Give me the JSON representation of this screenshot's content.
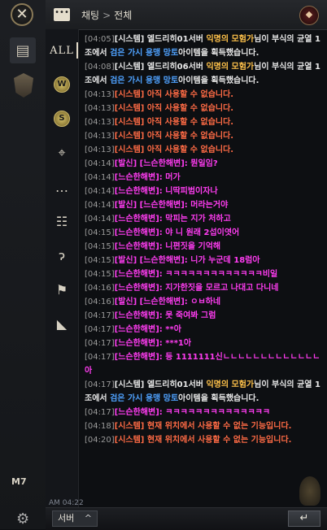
{
  "header": {
    "tab": "채팅",
    "sep": ">",
    "channel": "전체"
  },
  "rail": {
    "bottom_label": "M7"
  },
  "filters": [
    {
      "label": "ALL",
      "icon": "all-icon"
    },
    {
      "label": "W",
      "icon": "world-chat-icon"
    },
    {
      "label": "S",
      "icon": "server-chat-icon"
    },
    {
      "label": "",
      "icon": "location-pin-icon"
    },
    {
      "label": "",
      "icon": "speech-bubble-icon"
    },
    {
      "label": "",
      "icon": "party-icon"
    },
    {
      "label": "",
      "icon": "whisper-ear-icon"
    },
    {
      "label": "",
      "icon": "guild-banner-icon"
    },
    {
      "label": "",
      "icon": "megaphone-icon"
    }
  ],
  "messages": [
    {
      "type": "sys-white",
      "ts": "[04:05]",
      "parts": [
        [
          "",
          "[시스템] 엘드리히01서버 "
        ],
        [
          "gold",
          "익명의 모험가"
        ],
        [
          "",
          "님이 부식의 균열 1조에서 "
        ],
        [
          "blue",
          "검은 가시 용맹 망토"
        ],
        [
          "",
          "아이템을 획득했습니다."
        ]
      ]
    },
    {
      "type": "sys-white",
      "ts": "[04:08]",
      "parts": [
        [
          "",
          "[시스템] 엘드리히06서버 "
        ],
        [
          "gold",
          "익명의 모험가"
        ],
        [
          "",
          "님이 부식의 균열 1조에서 "
        ],
        [
          "blue",
          "검은 가시 용맹 망토"
        ],
        [
          "",
          "아이템을 획득했습니다."
        ]
      ]
    },
    {
      "type": "sys",
      "ts": "[04:13]",
      "parts": [
        [
          "",
          "[시스템] 아직 사용할 수 없습니다."
        ]
      ]
    },
    {
      "type": "sys",
      "ts": "[04:13]",
      "parts": [
        [
          "",
          "[시스템] 아직 사용할 수 없습니다."
        ]
      ]
    },
    {
      "type": "sys",
      "ts": "[04:13]",
      "parts": [
        [
          "",
          "[시스템] 아직 사용할 수 없습니다."
        ]
      ]
    },
    {
      "type": "sys",
      "ts": "[04:13]",
      "parts": [
        [
          "",
          "[시스템] 아직 사용할 수 없습니다."
        ]
      ]
    },
    {
      "type": "sys",
      "ts": "[04:13]",
      "parts": [
        [
          "",
          "[시스템] 아직 사용할 수 없습니다."
        ]
      ]
    },
    {
      "type": "shout",
      "ts": "[04:14]",
      "parts": [
        [
          "",
          "[발신] [느슨한해변]: 뭔일임?"
        ]
      ]
    },
    {
      "type": "shout",
      "ts": "[04:14]",
      "parts": [
        [
          "",
          "[느슨한해변]: 머가"
        ]
      ]
    },
    {
      "type": "shout",
      "ts": "[04:14]",
      "parts": [
        [
          "",
          "[느슨한해변]: 니딱피범이자나"
        ]
      ]
    },
    {
      "type": "shout",
      "ts": "[04:14]",
      "parts": [
        [
          "",
          "[발신] [느슨한해변]: 머라는거야"
        ]
      ]
    },
    {
      "type": "shout",
      "ts": "[04:14]",
      "parts": [
        [
          "",
          "[느슨한해변]: 막피는 지가 처하고"
        ]
      ]
    },
    {
      "type": "shout",
      "ts": "[04:15]",
      "parts": [
        [
          "",
          "[느슨한해변]: 야 니 원래 2섭이엿어"
        ]
      ]
    },
    {
      "type": "shout",
      "ts": "[04:15]",
      "parts": [
        [
          "",
          "[느슨한해변]: 니편짓을 기억해"
        ]
      ]
    },
    {
      "type": "shout",
      "ts": "[04:15]",
      "parts": [
        [
          "",
          "[발신] [느슨한해변]: 니가 누군데 18럼아"
        ]
      ]
    },
    {
      "type": "shout",
      "ts": "[04:15]",
      "parts": [
        [
          "",
          "[느슨한해변]: ㅋㅋㅋㅋㅋㅋㅋㅋㅋㅋㅋㅋㅋ비일"
        ]
      ]
    },
    {
      "type": "shout",
      "ts": "[04:16]",
      "parts": [
        [
          "",
          "[느슨한해변]: 지가한짓을 모르고 나대고 다니네"
        ]
      ]
    },
    {
      "type": "shout",
      "ts": "[04:16]",
      "parts": [
        [
          "",
          "[발신] [느슨한해변]: ㅇㅂ하네"
        ]
      ]
    },
    {
      "type": "shout",
      "ts": "[04:17]",
      "parts": [
        [
          "",
          "[느슨한해변]: 못 죽여봐 그럼"
        ]
      ]
    },
    {
      "type": "shout",
      "ts": "[04:17]",
      "parts": [
        [
          "",
          "[느슨한해변]: **아"
        ]
      ]
    },
    {
      "type": "shout",
      "ts": "[04:17]",
      "parts": [
        [
          "",
          "[느슨한해변]: ***1아"
        ]
      ]
    },
    {
      "type": "shout",
      "ts": "[04:17]",
      "parts": [
        [
          "",
          "[느슨한해변]: 등 1111111신ㄴㄴㄴㄴㄴㄴㄴㄴㄴㄴㄴㄴㄴ아"
        ]
      ]
    },
    {
      "type": "sys-white",
      "ts": "[04:17]",
      "parts": [
        [
          "",
          "[시스템] 엘드리히01서버 "
        ],
        [
          "gold",
          "익명의 모험가"
        ],
        [
          "",
          "님이 부식의 균열 1조에서 "
        ],
        [
          "blue",
          "검은 가시 용맹 망토"
        ],
        [
          "",
          "아이템을 획득했습니다."
        ]
      ]
    },
    {
      "type": "shout",
      "ts": "[04:17]",
      "parts": [
        [
          "",
          "[느슨한해변]: ㅋㅋㅋㅋㅋㅋㅋㅋㅋㅋㅋㅋㅋㅋ"
        ]
      ]
    },
    {
      "type": "sys",
      "ts": "[04:18]",
      "parts": [
        [
          "",
          "[시스템] 현재 위치에서 사용할 수 없는 기능입니다."
        ]
      ]
    },
    {
      "type": "sys",
      "ts": "[04:20]",
      "parts": [
        [
          "",
          "[시스템] 현재 위치에서 사용할 수 없는 기능입니다."
        ]
      ]
    }
  ],
  "footer": {
    "server": "서버",
    "chevron": "^",
    "send": "↵",
    "overlay_time": "AM 04:22"
  }
}
